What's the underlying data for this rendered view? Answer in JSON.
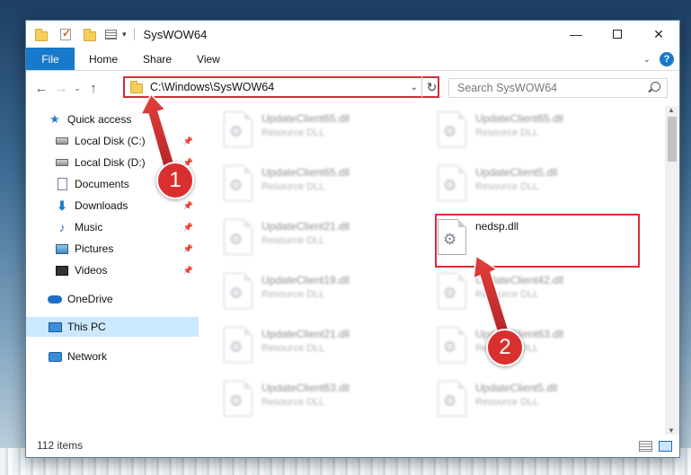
{
  "window": {
    "title": "SysWOW64"
  },
  "ribbon": {
    "tabs": [
      "File",
      "Home",
      "Share",
      "View"
    ],
    "help_label": "?"
  },
  "address": {
    "path": "C:\\Windows\\SysWOW64",
    "search_placeholder": "Search SysWOW64"
  },
  "sidebar": {
    "items": [
      {
        "label": "Quick access",
        "icon": "star-icon"
      },
      {
        "label": "Local Disk (C:)",
        "icon": "drive-icon"
      },
      {
        "label": "Local Disk (D:)",
        "icon": "drive-icon"
      },
      {
        "label": "Documents",
        "icon": "documents-icon"
      },
      {
        "label": "Downloads",
        "icon": "downloads-icon"
      },
      {
        "label": "Music",
        "icon": "music-icon"
      },
      {
        "label": "Pictures",
        "icon": "pictures-icon"
      },
      {
        "label": "Videos",
        "icon": "videos-icon"
      },
      {
        "label": "OneDrive",
        "icon": "onedrive-icon"
      },
      {
        "label": "This PC",
        "icon": "this-pc-icon"
      },
      {
        "label": "Network",
        "icon": "network-icon"
      }
    ]
  },
  "files": [
    {
      "name": "UpdateClient65.dll",
      "type": "Resource DLL"
    },
    {
      "name": "UpdateClient65.dll",
      "type": "Resource DLL"
    },
    {
      "name": "UpdateClient65.dll",
      "type": "Resource DLL"
    },
    {
      "name": "UpdateClient5.dll",
      "type": "Resource DLL"
    },
    {
      "name": "UpdateClient21.dll",
      "type": "Resource DLL"
    },
    {
      "name": "nedsp.dll",
      "type": ""
    },
    {
      "name": "UpdateClient19.dll",
      "type": "Resource DLL"
    },
    {
      "name": "UpdateClient42.dll",
      "type": "Resource DLL"
    },
    {
      "name": "UpdateClient21.dll",
      "type": "Resource DLL"
    },
    {
      "name": "UpdateClient63.dll",
      "type": "Resource DLL"
    },
    {
      "name": "UpdateClient63.dll",
      "type": "Resource DLL"
    },
    {
      "name": "UpdateClient5.dll",
      "type": "Resource DLL"
    }
  ],
  "status": {
    "item_count": "112 items"
  },
  "annotations": {
    "step1": "1",
    "step2": "2",
    "color": "#d9302f"
  }
}
